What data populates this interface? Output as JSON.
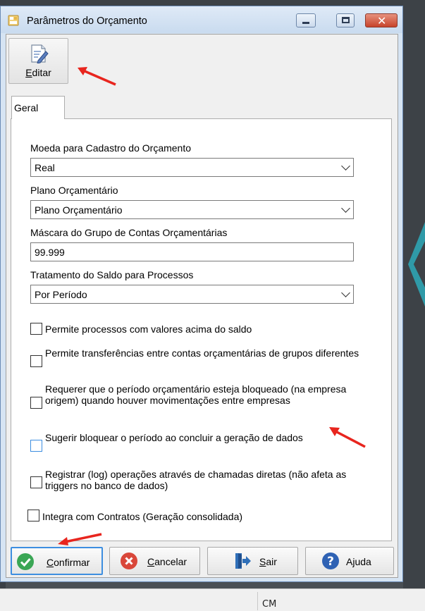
{
  "window": {
    "title": "Parâmetros do Orçamento"
  },
  "toolbar": {
    "edit_label": "Editar"
  },
  "tabs": [
    {
      "label": "Geral"
    }
  ],
  "fields": {
    "currency": {
      "label": "Moeda para Cadastro do Orçamento",
      "value": "Real"
    },
    "budget_plan": {
      "label": "Plano Orçamentário",
      "value": "Plano Orçamentário"
    },
    "mask": {
      "label": "Máscara do Grupo de Contas Orçamentárias",
      "value": "99.999"
    },
    "balance_treatment": {
      "label": "Tratamento do Saldo para Processos",
      "value": "Por Período"
    }
  },
  "checkboxes": [
    {
      "label": "Permite processos com valores acima do saldo",
      "checked": false
    },
    {
      "label": "Permite transferências entre contas orçamentárias de grupos diferentes",
      "checked": false
    },
    {
      "label": "Requerer que o período orçamentário esteja bloqueado (na empresa origem) quando houver movimentações entre empresas",
      "checked": false
    },
    {
      "label": "Sugerir bloquear o período ao concluir a geração de dados",
      "checked": false
    },
    {
      "label": "Registrar (log) operações através de chamadas diretas (não afeta as triggers no banco de dados)",
      "checked": false
    },
    {
      "label": "Integra com Contratos (Geração consolidada)",
      "checked": false
    }
  ],
  "buttons": {
    "confirm": "Confirmar",
    "cancel": "Cancelar",
    "exit": "Sair",
    "help": "Ajuda"
  },
  "statusbar": {
    "text": "CM"
  },
  "colors": {
    "annotation_arrow": "#e8251e",
    "focus_blue": "#3d8ee0",
    "confirm_green": "#3aa655",
    "cancel_red": "#d9473a",
    "help_blue": "#2f62b4",
    "exit_blue": "#2f6fb8"
  }
}
